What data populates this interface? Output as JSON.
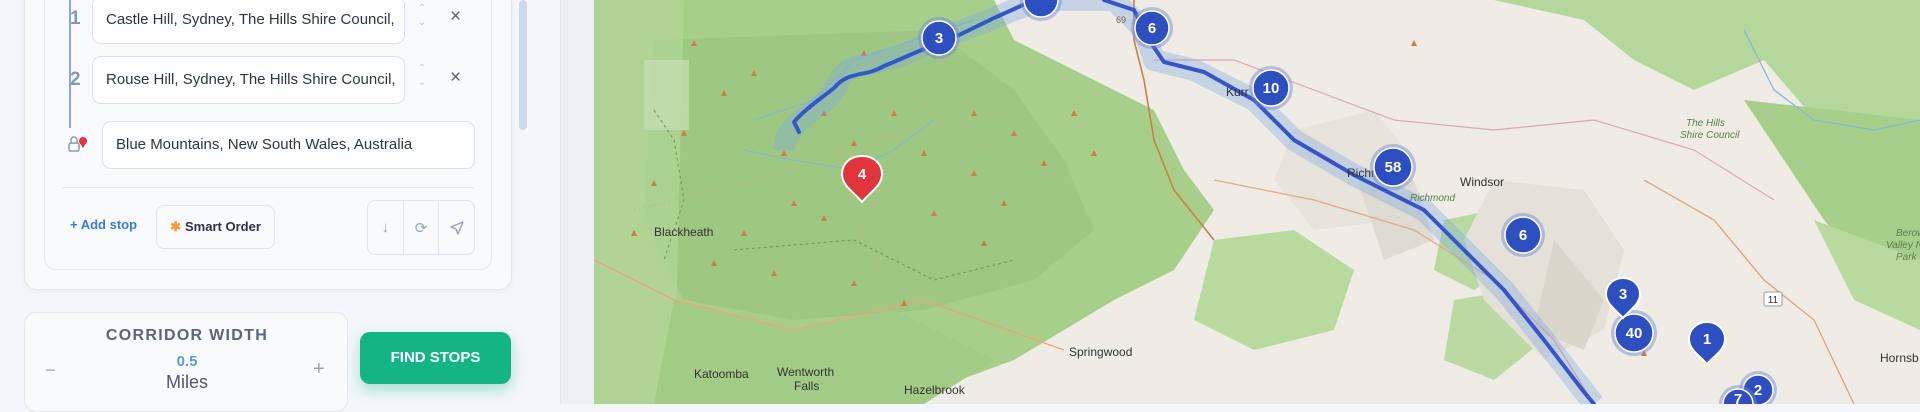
{
  "route": {
    "stops": [
      {
        "number": "1",
        "value": "Castle Hill, Sydney, The Hills Shire Council,"
      },
      {
        "number": "2",
        "value": "Rouse Hill, Sydney, The Hills Shire Council,"
      }
    ],
    "destination": {
      "value": "Blue Mountains, New South Wales, Australia"
    },
    "add_stop_label": "+ Add stop",
    "smart_order_label": "Smart Order",
    "icons": [
      "sort-down-icon",
      "refresh-icon",
      "navigate-icon"
    ]
  },
  "corridor": {
    "title": "CORRIDOR WIDTH",
    "value": "0.5",
    "unit": "Miles",
    "decrement": "−",
    "increment": "+"
  },
  "find_stops_label": "FIND STOPS",
  "map": {
    "places": {
      "blackheath": "Blackheath",
      "katoomba": "Katoomba",
      "wentworth1": "Wentworth",
      "wentworth2": "Falls",
      "hazelbrook": "Hazelbrook",
      "springwood": "Springwood",
      "kurr": "Kurr",
      "richmond1": "Richm",
      "richmond2": "Richmond",
      "windsor": "Windsor",
      "hornsb": "Hornsb",
      "hills1": "The Hills",
      "hills2": "Shire Council",
      "berow1": "Berow",
      "berow2": "Valley Na",
      "berow3": "Park",
      "road11": "11",
      "road69": "69"
    },
    "clusters": [
      "3",
      "6",
      "10",
      "58",
      "6",
      "40",
      "2"
    ],
    "markers": {
      "red": "4",
      "blue_pin_1": "3",
      "blue_pin_2": "1",
      "partial": "7"
    },
    "colors": {
      "route": "#3556c9",
      "cluster": "#2e4fbf",
      "red_marker": "#e0353d",
      "park": "#a7cf8a",
      "urban": "#eeece4"
    }
  }
}
